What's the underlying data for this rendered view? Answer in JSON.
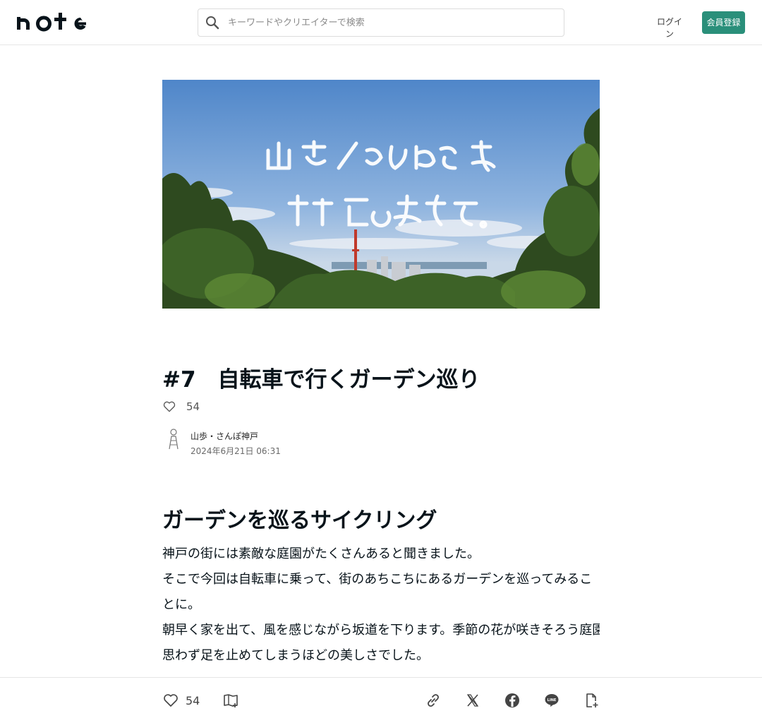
{
  "header": {
    "search_placeholder": "キーワードやクリエイターで検索",
    "login_label": "ログイン",
    "register_label": "会員登録"
  },
  "article": {
    "title": "#7　自転車で行くガーデン巡り",
    "likes": "54",
    "author_name": "山歩・さんぽ神戸",
    "date": "2024年6月21日 06:31",
    "heading": "ガーデンを巡るサイクリング",
    "paragraphs": [
      [
        "神戸の街には素敵な庭園がたくさんあると聞きました。",
        "そこで今回は自転車に乗って、街のあちこちにあるガーデンを巡ってみることに。"
      ],
      [
        "朝早く家を出て、風を感じながら坂道を下ります。季節の花が咲きそろう庭園では、色とりどりのバラやアジサイが出迎えてくれて",
        "思わず足を止めてしまうほどの美しさでした。"
      ]
    ]
  },
  "bottom_bar": {
    "likes": "54"
  },
  "colors": {
    "accent": "#2a8f7a",
    "text": "#08131a"
  },
  "icons": [
    "search-icon",
    "heart-icon",
    "magazine-add-icon",
    "link-icon",
    "x-icon",
    "facebook-icon",
    "line-icon",
    "embed-icon"
  ]
}
